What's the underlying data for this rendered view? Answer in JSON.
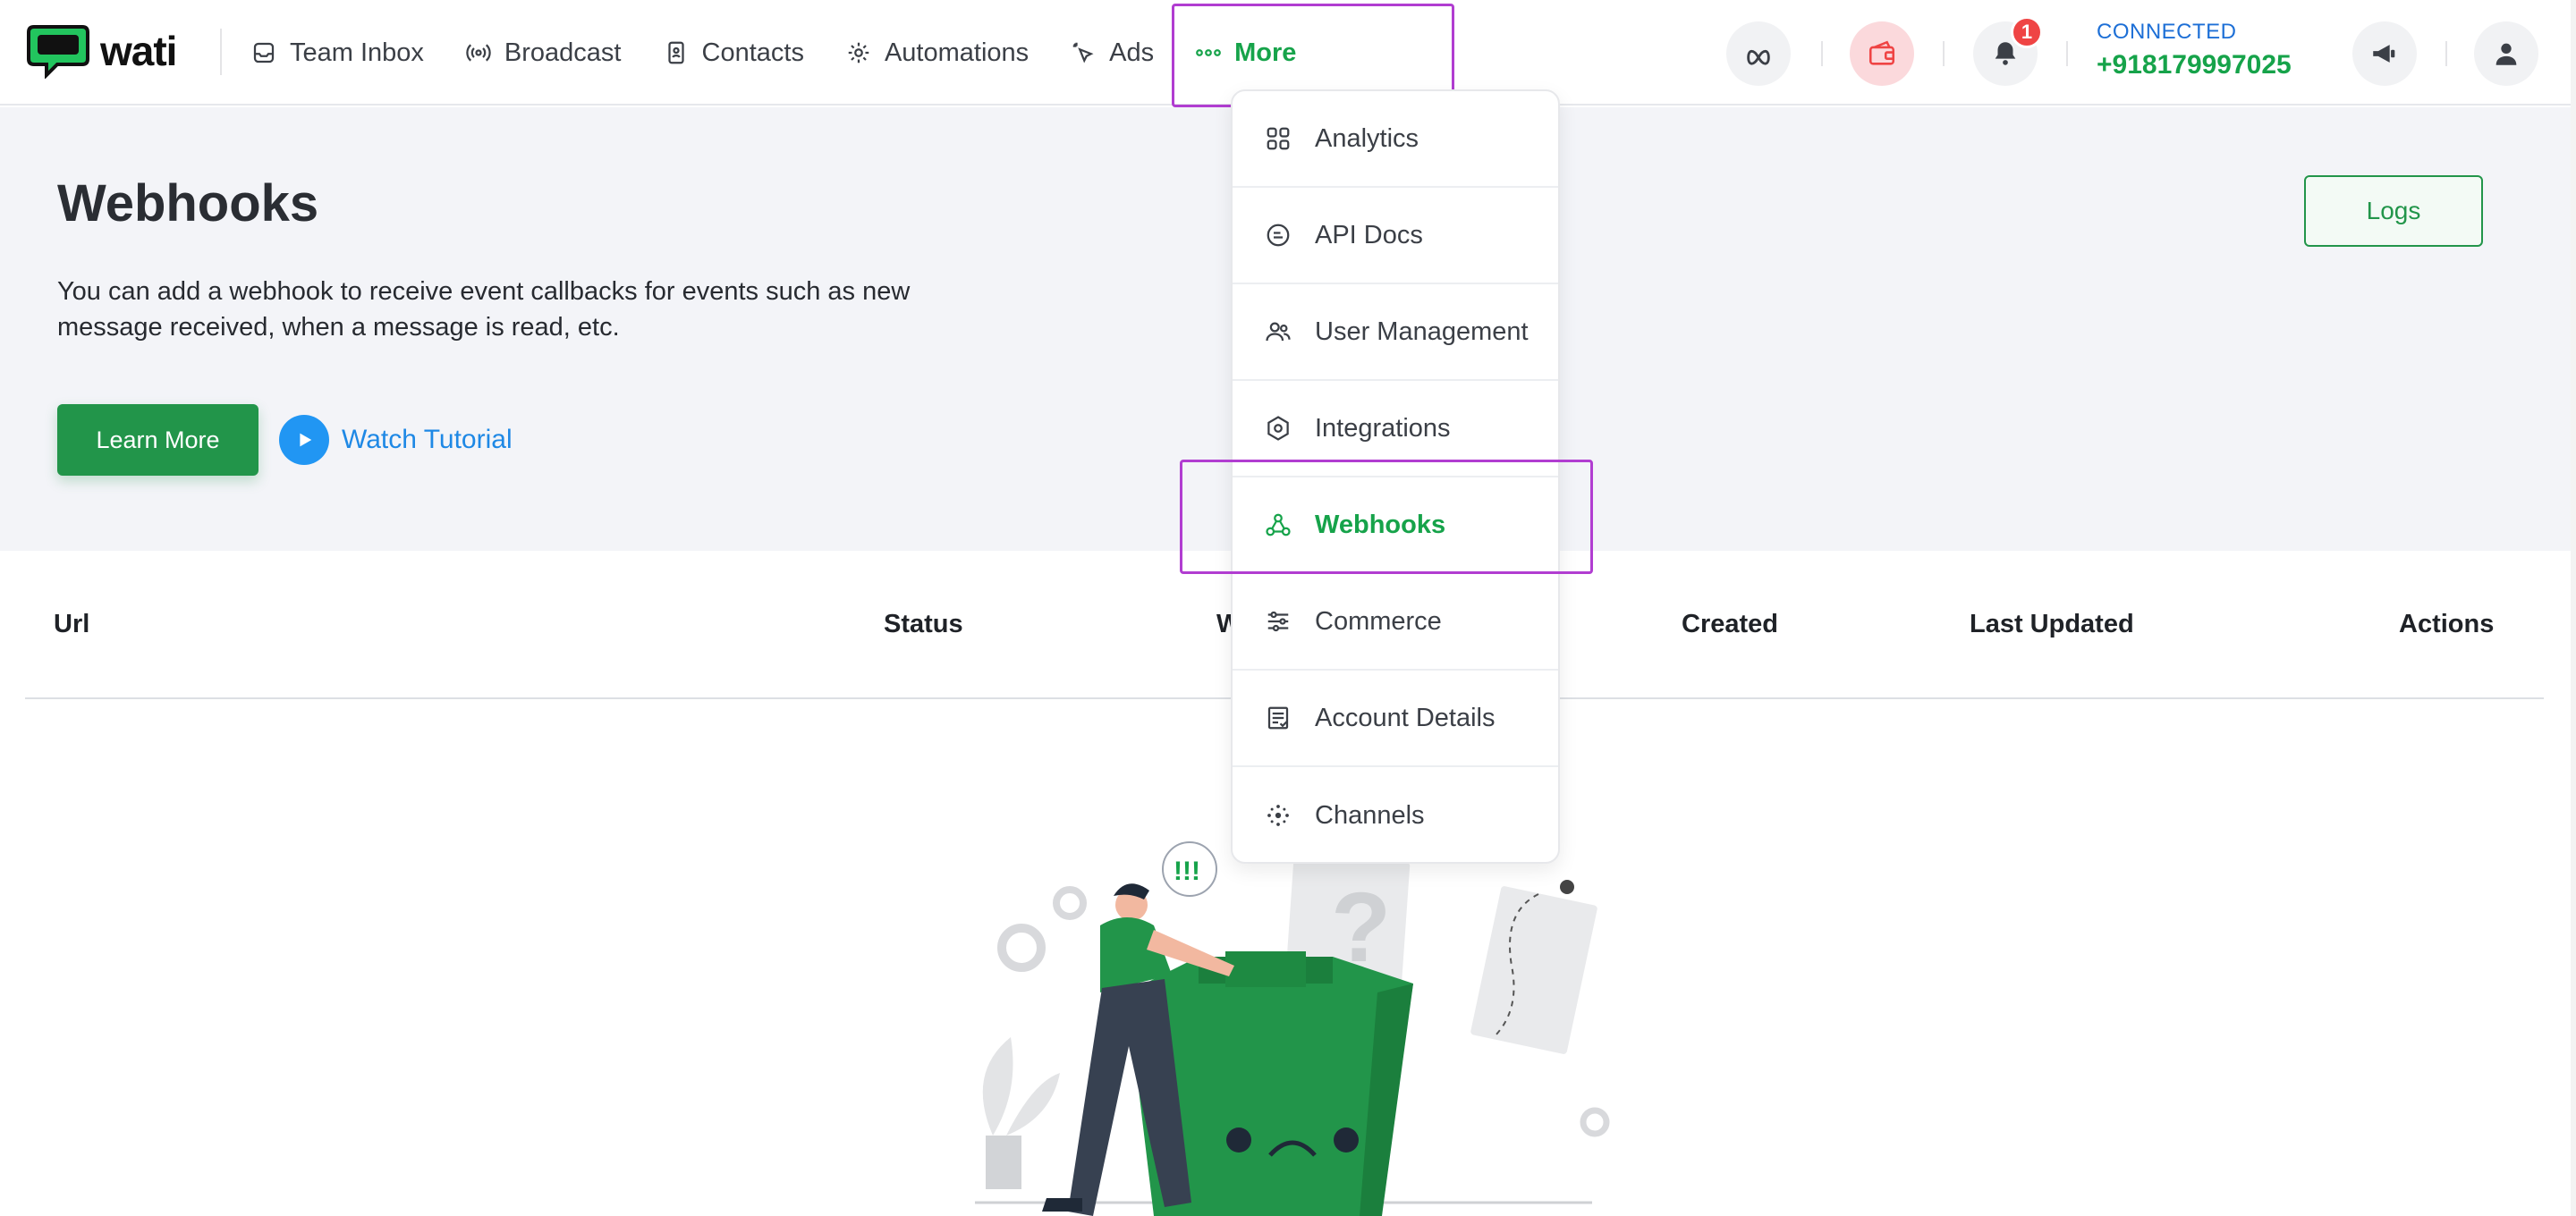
{
  "app": {
    "logo_text": "wati"
  },
  "nav": {
    "items": [
      {
        "label": "Team Inbox",
        "icon": "inbox-icon"
      },
      {
        "label": "Broadcast",
        "icon": "broadcast-icon"
      },
      {
        "label": "Contacts",
        "icon": "contacts-icon"
      },
      {
        "label": "Automations",
        "icon": "gear-icon"
      },
      {
        "label": "Ads",
        "icon": "cursor-click-icon"
      },
      {
        "label": "More",
        "icon": "more-dots-icon",
        "active": true
      }
    ]
  },
  "status": {
    "connection": "CONNECTED",
    "phone": "+918179997025",
    "notifications_count": "1"
  },
  "hero": {
    "title": "Webhooks",
    "description": "You can add a webhook to receive event callbacks for events such as new message received, when a message is read, etc.",
    "learn_more": "Learn More",
    "watch_tutorial": "Watch Tutorial",
    "logs": "Logs"
  },
  "table": {
    "columns": [
      "Url",
      "Status",
      "W",
      "Created",
      "Last Updated",
      "Actions"
    ]
  },
  "more_menu": {
    "items": [
      {
        "label": "Analytics",
        "icon": "grid-icon"
      },
      {
        "label": "API Docs",
        "icon": "api-icon"
      },
      {
        "label": "User Management",
        "icon": "users-icon"
      },
      {
        "label": "Integrations",
        "icon": "integrations-icon"
      },
      {
        "label": "Webhooks",
        "icon": "webhook-icon",
        "active": true
      },
      {
        "label": "Commerce",
        "icon": "commerce-icon"
      },
      {
        "label": "Account Details",
        "icon": "account-details-icon"
      },
      {
        "label": "Channels",
        "icon": "channels-icon"
      }
    ]
  },
  "illustration": {
    "exclamation": "!!!",
    "question": "?"
  },
  "colors": {
    "brand_green": "#22954a",
    "active_green": "#16a34a",
    "link_blue": "#1e88e5",
    "highlight_purple": "#b13dd1",
    "badge_red": "#ef4444"
  }
}
